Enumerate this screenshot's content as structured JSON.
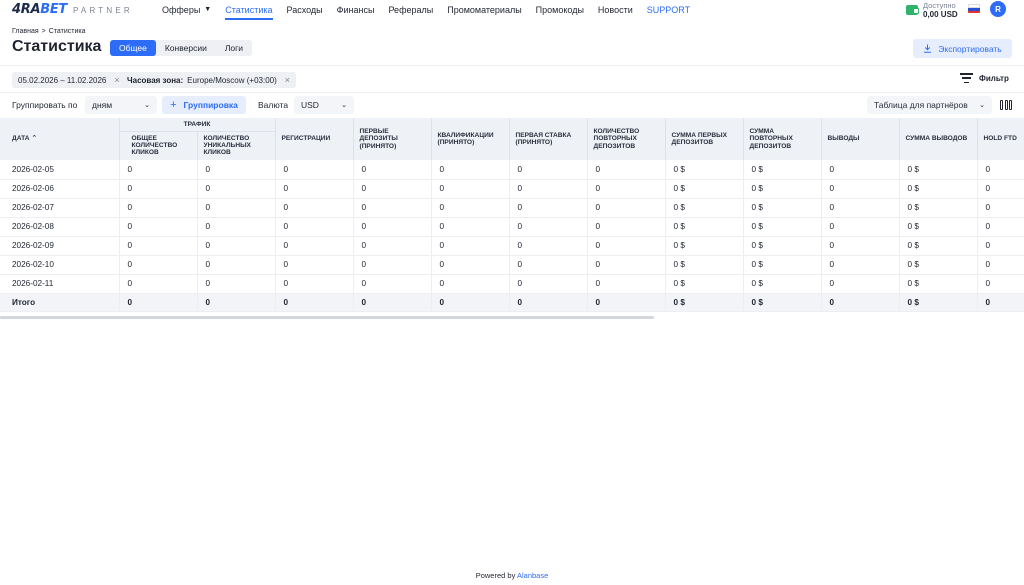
{
  "brand": {
    "logo_main": "4RA",
    "logo_accent": "BET",
    "logo_sub": "PARTNER"
  },
  "nav": [
    {
      "label": "Офферы",
      "has_dropdown": true,
      "active": false
    },
    {
      "label": "Статистика",
      "active": true
    },
    {
      "label": "Расходы",
      "active": false
    },
    {
      "label": "Финансы",
      "active": false
    },
    {
      "label": "Рефералы",
      "active": false
    },
    {
      "label": "Промоматериалы",
      "active": false
    },
    {
      "label": "Промокоды",
      "active": false
    },
    {
      "label": "Новости",
      "active": false
    },
    {
      "label": "SUPPORT",
      "active": false
    }
  ],
  "balance": {
    "label": "Доступно",
    "value": "0,00 USD"
  },
  "user": {
    "avatar_letter": "R"
  },
  "breadcrumb": {
    "home": "Главная",
    "separator": ">",
    "current": "Статистика"
  },
  "page_title": "Статистика",
  "tabs": [
    {
      "label": "Общее",
      "active": true
    },
    {
      "label": "Конверсии",
      "active": false
    },
    {
      "label": "Логи",
      "active": false
    }
  ],
  "export_label": "Экспортировать",
  "chips": {
    "date_range": "05.02.2026 – 11.02.2026",
    "timezone_label": "Часовая зона:",
    "timezone_value": "Europe/Moscow (+03:00)"
  },
  "filter_label": "Фильтр",
  "controls": {
    "group_by_label": "Группировать по",
    "group_by_value": "дням",
    "grouping_button": "Группировка",
    "currency_label": "Валюта",
    "currency_value": "USD",
    "table_view_value": "Таблица для партнёров"
  },
  "table": {
    "group_header": "Трафик",
    "columns": [
      "Дата",
      "Общее количество кликов",
      "Количество уникальных кликов",
      "Регистрации",
      "Первые депозиты (принято)",
      "Квалификации (принято)",
      "Первая ставка (принято)",
      "Количество повторных депозитов",
      "Сумма первых депозитов",
      "Сумма повторных депозитов",
      "Выводы",
      "Сумма выводов",
      "Hold FTD"
    ],
    "rows": [
      [
        "2026-02-05",
        "0",
        "0",
        "0",
        "0",
        "0",
        "0",
        "0",
        "0 $",
        "0 $",
        "0",
        "0 $",
        "0"
      ],
      [
        "2026-02-06",
        "0",
        "0",
        "0",
        "0",
        "0",
        "0",
        "0",
        "0 $",
        "0 $",
        "0",
        "0 $",
        "0"
      ],
      [
        "2026-02-07",
        "0",
        "0",
        "0",
        "0",
        "0",
        "0",
        "0",
        "0 $",
        "0 $",
        "0",
        "0 $",
        "0"
      ],
      [
        "2026-02-08",
        "0",
        "0",
        "0",
        "0",
        "0",
        "0",
        "0",
        "0 $",
        "0 $",
        "0",
        "0 $",
        "0"
      ],
      [
        "2026-02-09",
        "0",
        "0",
        "0",
        "0",
        "0",
        "0",
        "0",
        "0 $",
        "0 $",
        "0",
        "0 $",
        "0"
      ],
      [
        "2026-02-10",
        "0",
        "0",
        "0",
        "0",
        "0",
        "0",
        "0",
        "0 $",
        "0 $",
        "0",
        "0 $",
        "0"
      ],
      [
        "2026-02-11",
        "0",
        "0",
        "0",
        "0",
        "0",
        "0",
        "0",
        "0 $",
        "0 $",
        "0",
        "0 $",
        "0"
      ]
    ],
    "total": [
      "Итого",
      "0",
      "0",
      "0",
      "0",
      "0",
      "0",
      "0",
      "0 $",
      "0 $",
      "0",
      "0 $",
      "0"
    ]
  },
  "footer": {
    "prefix": "Powered by",
    "brand": "Alanbase"
  },
  "colors": {
    "accent": "#2d6cf6",
    "accent_bg": "#e6eefe",
    "wallet": "#2fb36a"
  }
}
